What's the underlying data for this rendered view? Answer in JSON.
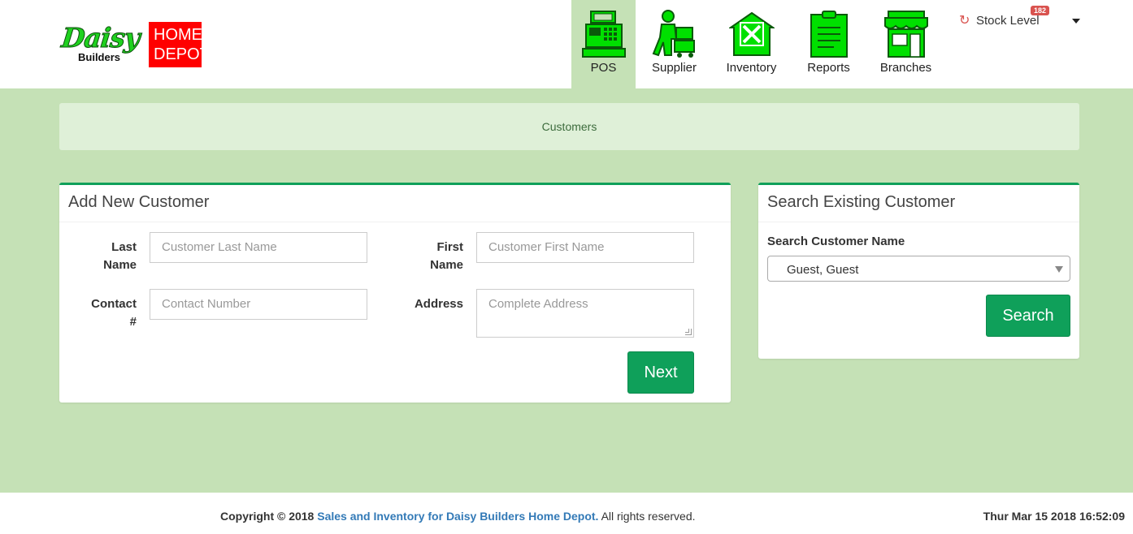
{
  "brand": {
    "daisy": "Daisy",
    "builders": "Builders",
    "home_line1": "HOME",
    "home_line2": "DEPOT"
  },
  "nav": [
    {
      "label": "POS",
      "icon": "cash-register-icon",
      "active": true
    },
    {
      "label": "Supplier",
      "icon": "supplier-icon",
      "active": false
    },
    {
      "label": "Inventory",
      "icon": "warehouse-icon",
      "active": false
    },
    {
      "label": "Reports",
      "icon": "clipboard-icon",
      "active": false
    },
    {
      "label": "Branches",
      "icon": "storefront-icon",
      "active": false
    }
  ],
  "stock": {
    "label": "Stock Level",
    "badge": "182",
    "icon": "refresh-icon"
  },
  "page_title": "Customers",
  "add_customer": {
    "heading": "Add New Customer",
    "last_name_label": "Last Name",
    "last_name_placeholder": "Customer Last Name",
    "first_name_label": "First Name",
    "first_name_placeholder": "Customer First Name",
    "contact_label": "Contact #",
    "contact_placeholder": "Contact Number",
    "address_label": "Address",
    "address_placeholder": "Complete Address",
    "next_button": "Next"
  },
  "search_customer": {
    "heading": "Search Existing Customer",
    "name_label": "Search Customer Name",
    "selected": "Guest, Guest",
    "search_button": "Search"
  },
  "footer": {
    "copyright": "Copyright © 2018",
    "link_text": "Sales and Inventory for Daisy Builders Home Depot.",
    "rights": "All rights reserved.",
    "datetime": "Thur Mar 15 2018 16:52:09"
  },
  "colors": {
    "background": "#c5e1b6",
    "accent": "#0fa05a",
    "icon_green": "#00e000",
    "brand_red": "#ff0000",
    "title_bar": "#dff0d8",
    "link": "#337ab7"
  }
}
